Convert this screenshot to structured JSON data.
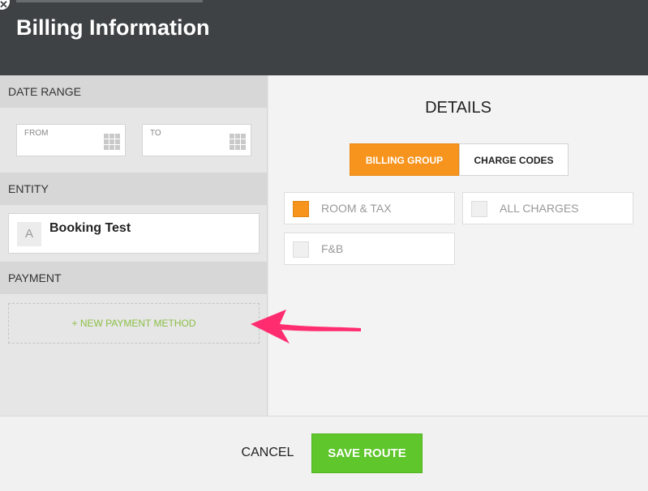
{
  "header": {
    "title": "Billing Information",
    "close_glyph": "✕",
    "close_icon": "close-icon"
  },
  "sidebar": {
    "date_range": {
      "heading": "DATE RANGE",
      "from_label": "FROM",
      "to_label": "TO",
      "calendar_icon": "calendar-grid-icon"
    },
    "entity": {
      "heading": "ENTITY",
      "badge": "A",
      "name": "Booking Test"
    },
    "payment": {
      "heading": "PAYMENT",
      "new_method": "+ NEW PAYMENT METHOD"
    }
  },
  "details": {
    "title": "DETAILS",
    "tabs": [
      {
        "label": "BILLING GROUP",
        "active": true
      },
      {
        "label": "CHARGE CODES",
        "active": false
      }
    ],
    "options": [
      {
        "label": "ROOM & TAX",
        "checked": true
      },
      {
        "label": "ALL CHARGES",
        "checked": false
      },
      {
        "label": "F&B",
        "checked": false
      }
    ]
  },
  "footer": {
    "cancel_label": "CANCEL",
    "save_label": "SAVE ROUTE"
  },
  "colors": {
    "header_bg": "#3f4244",
    "accent_orange": "#f7941e",
    "save_green": "#5fc62c",
    "payment_link_green": "#8bbf45",
    "annotation_arrow": "#ff2d6f"
  },
  "annotation": {
    "arrow_icon": "annotation-arrow-icon"
  }
}
